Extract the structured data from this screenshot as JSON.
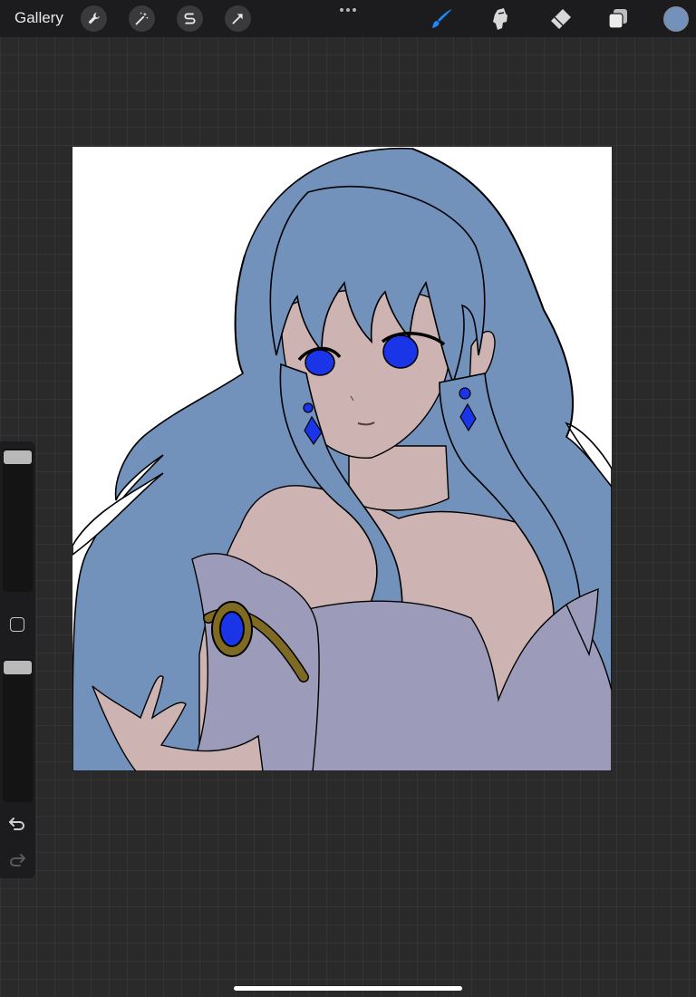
{
  "topbar": {
    "gallery_label": "Gallery",
    "tools_left": [
      "wrench-icon",
      "magic-wand-icon",
      "selection-s-icon",
      "transform-arrow-icon"
    ],
    "tools_right": [
      "brush-icon",
      "smudge-icon",
      "eraser-icon",
      "layers-icon"
    ],
    "active_tool": "brush-icon",
    "active_color": "#7292bc"
  },
  "sidebar": {
    "controls": [
      "brush-size-slider",
      "modify-button",
      "opacity-slider",
      "undo-icon",
      "redo-icon"
    ]
  },
  "colors": {
    "hair": "#7292bc",
    "skin": "#cdb3b2",
    "dress": "#9d9bba",
    "eye": "#1a34e8",
    "gold": "#7f6a23",
    "brush_accent": "#1e88ff"
  }
}
